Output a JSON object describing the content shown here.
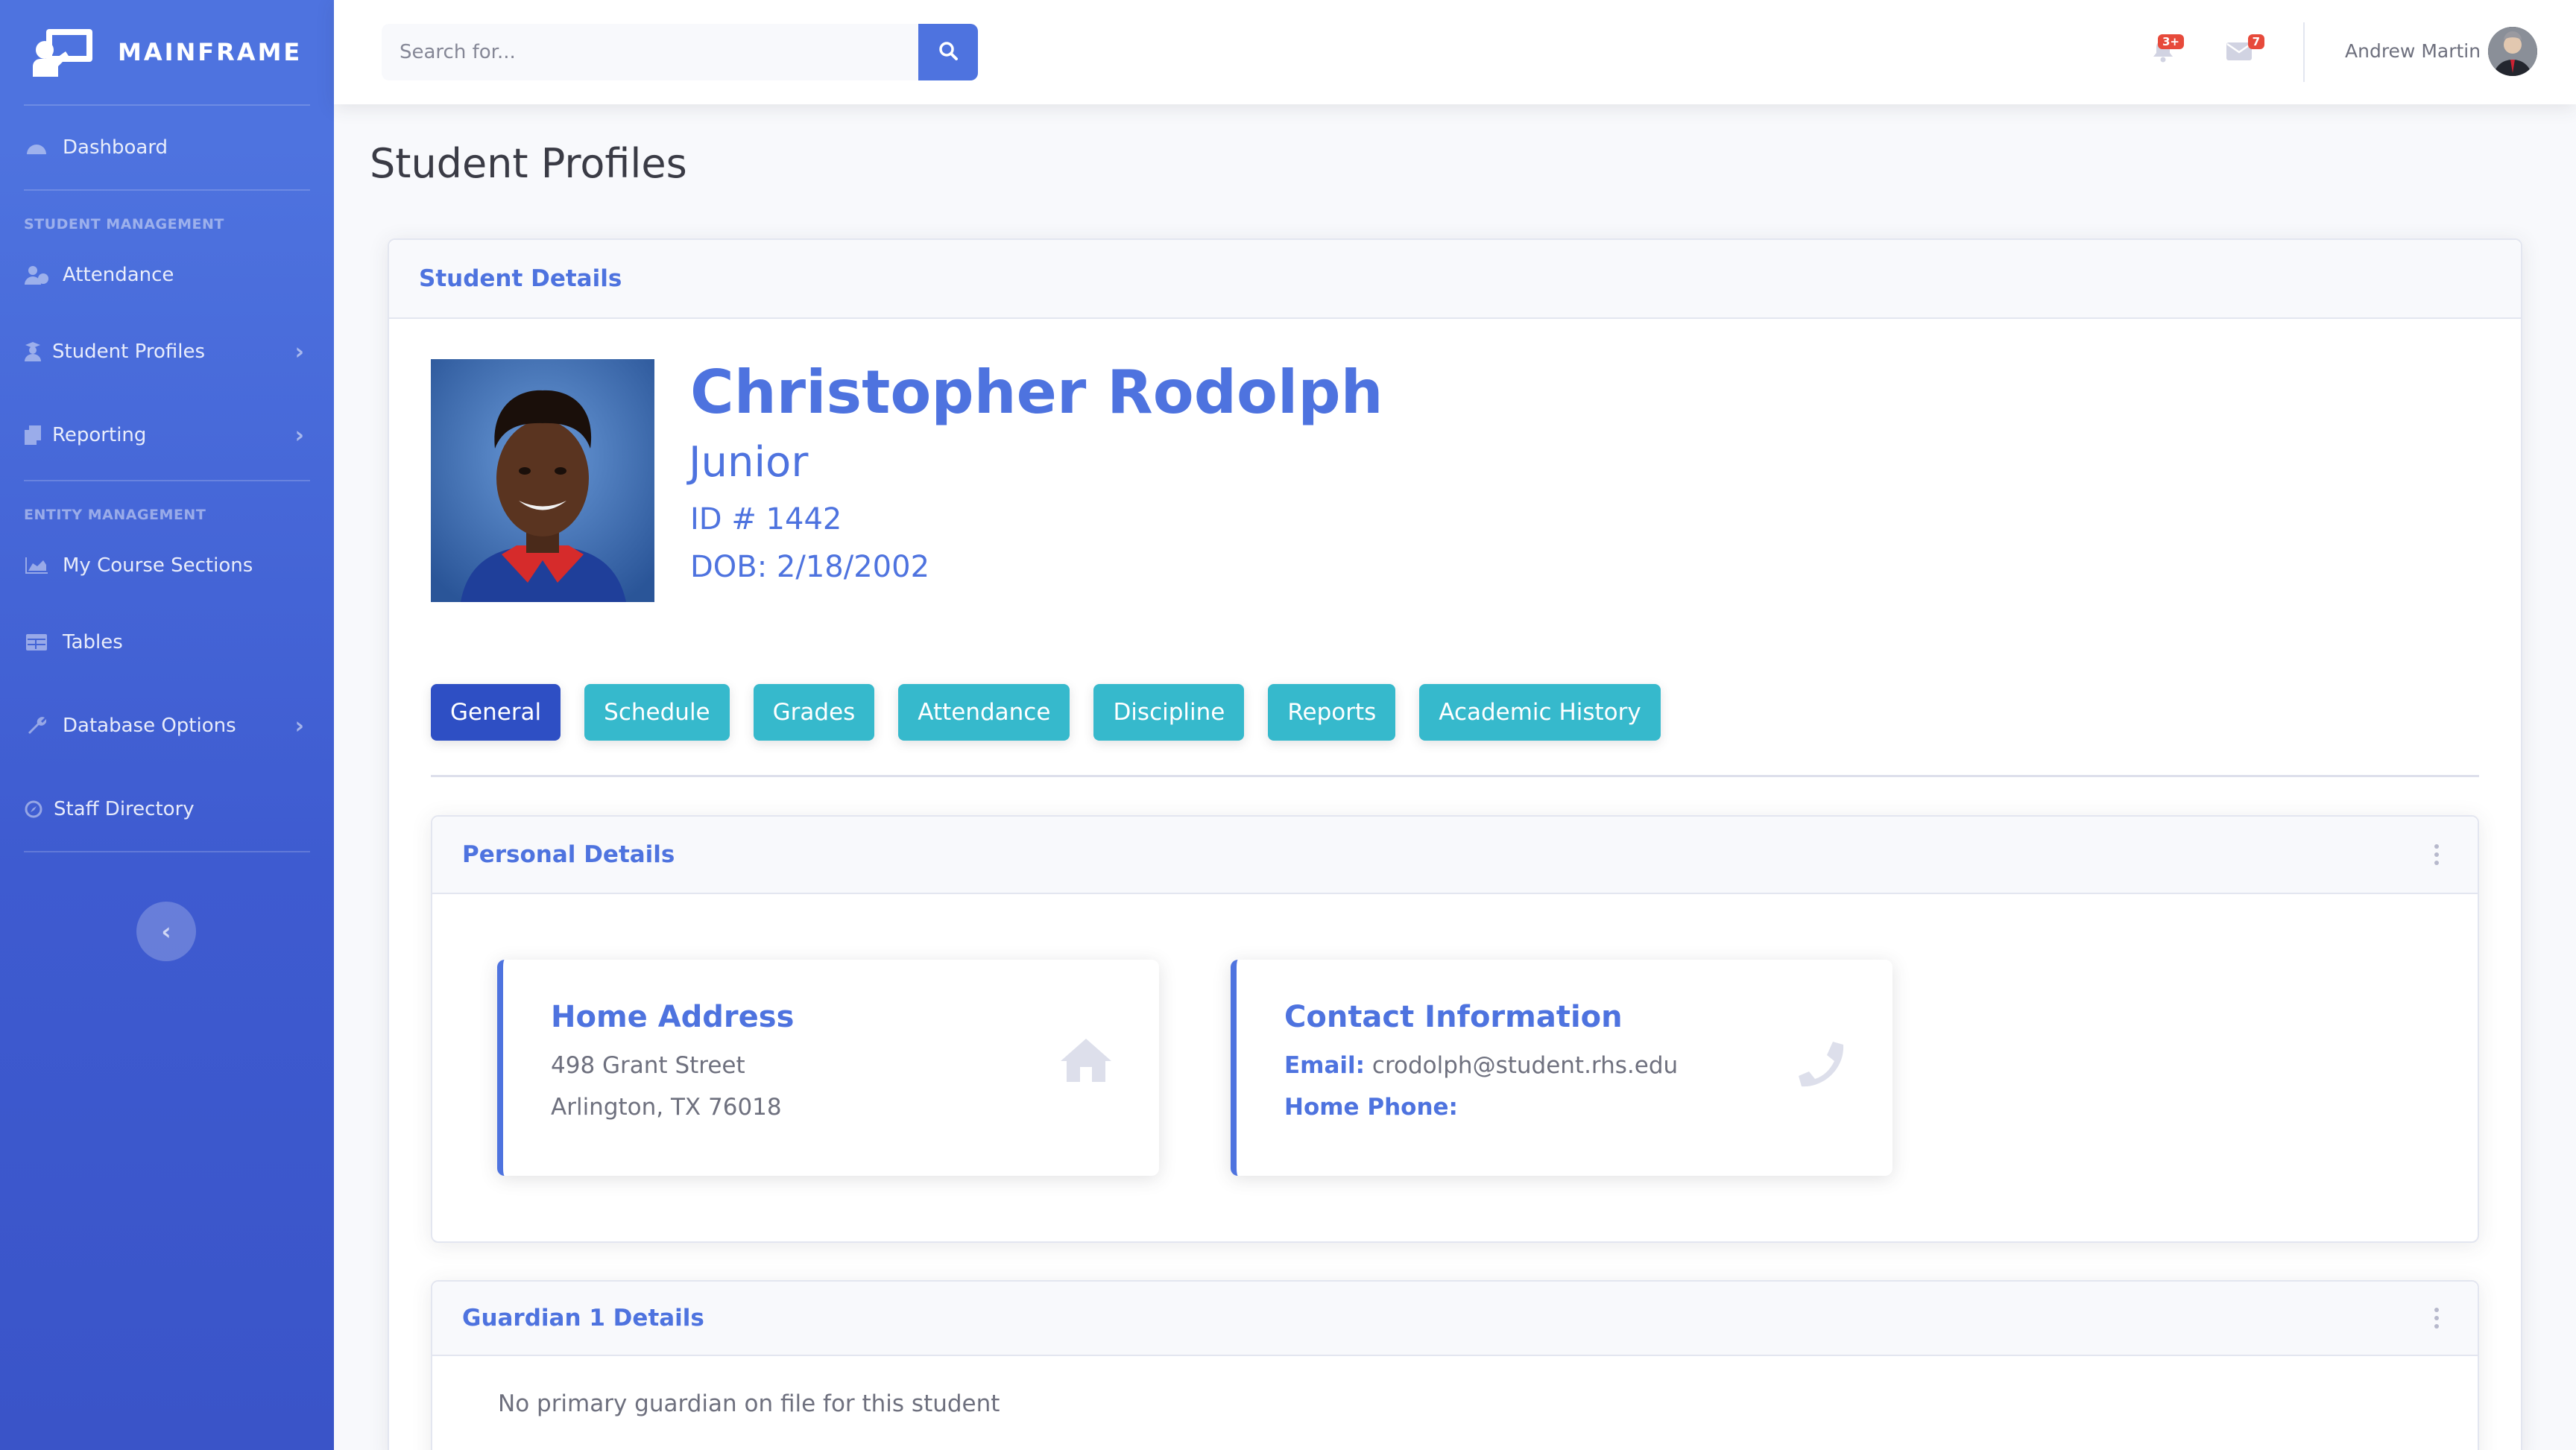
{
  "brand": {
    "name": "MAINFRAME"
  },
  "sidebar": {
    "items": [
      {
        "label": "Dashboard",
        "icon": "dashboard-icon"
      },
      {
        "label": "Attendance",
        "icon": "user-clock-icon"
      },
      {
        "label": "Student Profiles",
        "icon": "user-graduate-icon"
      },
      {
        "label": "Reporting",
        "icon": "copy-icon"
      },
      {
        "label": "My Course Sections",
        "icon": "chart-area-icon"
      },
      {
        "label": "Tables",
        "icon": "table-icon"
      },
      {
        "label": "Database Options",
        "icon": "wrench-icon"
      },
      {
        "label": "Staff Directory",
        "icon": "compass-icon"
      }
    ],
    "sections": {
      "student_management": "STUDENT MANAGEMENT",
      "entity_management": "ENTITY MANAGEMENT"
    },
    "toggle_glyph": "‹"
  },
  "topbar": {
    "search_placeholder": "Search for...",
    "alerts_badge": "3+",
    "messages_badge": "7",
    "user_name": "Andrew Martin"
  },
  "page": {
    "title": "Student Profiles"
  },
  "student_card": {
    "header": "Student Details"
  },
  "student": {
    "name": "Christopher Rodolph",
    "grade": "Junior",
    "id_text": "ID # 1442",
    "dob_text": "DOB: 2/18/2002"
  },
  "tabs": [
    "General",
    "Schedule",
    "Grades",
    "Attendance",
    "Discipline",
    "Reports",
    "Academic History"
  ],
  "personal_details": {
    "header": "Personal Details",
    "home_address": {
      "title": "Home Address",
      "line1": "498 Grant Street",
      "line2": "Arlington, TX 76018"
    },
    "contact": {
      "title": "Contact Information",
      "email_label": "Email:",
      "email": "crodolph@student.rhs.edu",
      "phone_label": "Home Phone:",
      "phone": ""
    }
  },
  "guardian": {
    "header": "Guardian 1 Details",
    "message": "No primary guardian on file for this student"
  },
  "colors": {
    "primary": "#4e73df",
    "info": "#36b9cc",
    "active_tab": "#2e4fc4",
    "danger": "#e74a3b"
  }
}
